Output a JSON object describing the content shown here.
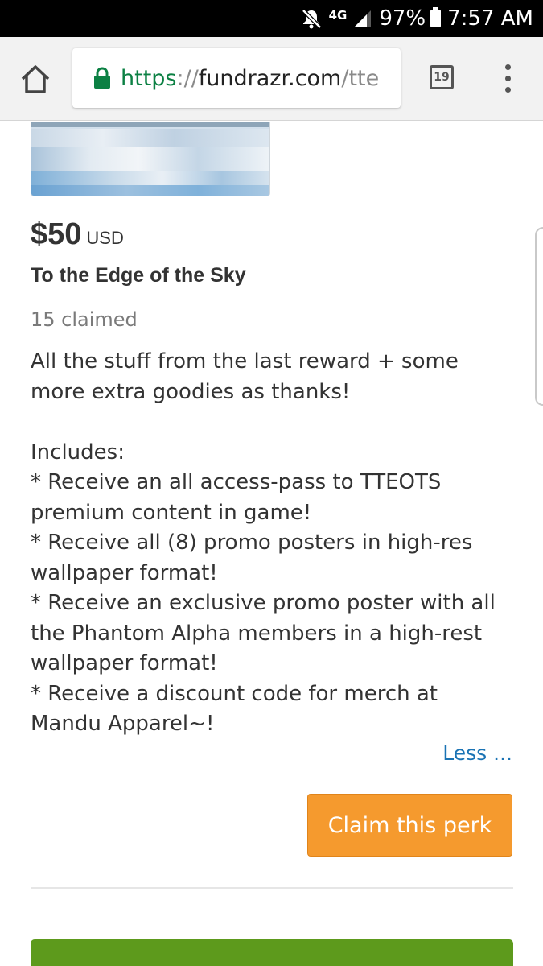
{
  "status_bar": {
    "network": "4G",
    "battery": "97%",
    "time": "7:57 AM",
    "icons": [
      "mute-icon",
      "network-4g-icon",
      "signal-icon",
      "battery-icon"
    ]
  },
  "browser": {
    "url": {
      "scheme": "https",
      "separator": "://",
      "host": "fundrazr.com",
      "path": "/tte"
    },
    "tab_count": "19",
    "icons": [
      "home-icon",
      "lock-icon",
      "tabs-icon",
      "more-vert-icon"
    ]
  },
  "perk": {
    "price": "$50",
    "currency": "USD",
    "title": "To the Edge of the Sky",
    "claimed": "15 claimed",
    "description": [
      "All the stuff from the last reward + some more extra goodies as thanks!",
      "",
      "Includes:",
      "* Receive an all access-pass to TTEOTS premium content in game!",
      "* Receive all (8) promo posters in high-res wallpaper format!",
      "* Receive an exclusive promo poster with all the Phantom Alpha members in a high-rest wallpaper format!",
      "* Receive a discount code for merch at Mandu Apparel~!"
    ],
    "less_link": "Less ...",
    "claim_button": "Claim this perk"
  },
  "colors": {
    "status_bar_bg": "#000000",
    "browser_bar_bg": "#f2f2f2",
    "secure_scheme": "#0b8043",
    "link": "#1a73b4",
    "claim_button_bg": "#f59a2e",
    "green_button_bg": "#5d9a1c",
    "text": "#333333",
    "muted_text": "#7a7a7a"
  }
}
